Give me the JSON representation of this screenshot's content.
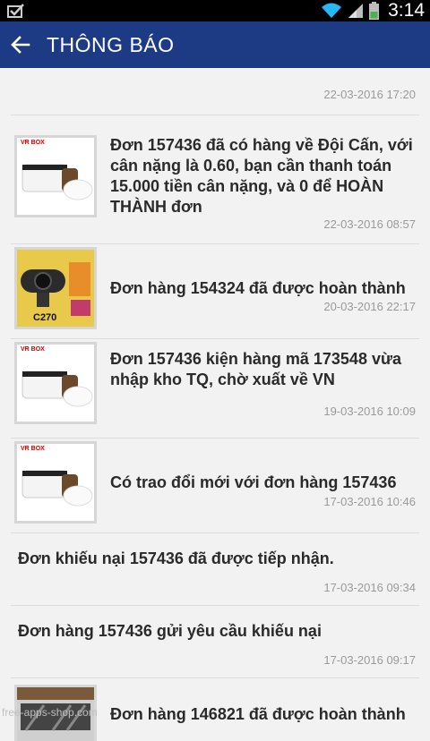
{
  "status_bar": {
    "time": "3:14"
  },
  "app_bar": {
    "title": "THÔNG BÁO"
  },
  "notifications": [
    {
      "message": "",
      "timestamp": "22-03-2016 17:20",
      "thumbnail": "none"
    },
    {
      "message": "Đơn 157436 đã có hàng về Đội Cấn, với cân nặng là 0.60, bạn cần thanh toán 15.000 tiền cân nặng, và 0 để HOÀN THÀNH đơn",
      "timestamp": "22-03-2016 08:57",
      "thumbnail": "vr-headset"
    },
    {
      "message": "Đơn hàng 154324 đã được hoàn thành",
      "timestamp": "20-03-2016 22:17",
      "thumbnail": "webcam-c270"
    },
    {
      "message": "Đơn 157436 kiện hàng mã 173548 vừa nhập kho TQ, chờ xuất về VN",
      "timestamp": "19-03-2016 10:09",
      "thumbnail": "vr-headset"
    },
    {
      "message": "Có trao đổi mới với đơn hàng 157436",
      "timestamp": "17-03-2016 10:46",
      "thumbnail": "vr-headset"
    },
    {
      "message": "Đơn khiếu nại 157436 đã được tiếp nhận.",
      "timestamp": "17-03-2016 09:34",
      "thumbnail": "none"
    },
    {
      "message": "Đơn hàng 157436 gửi yêu cầu khiếu nại",
      "timestamp": "17-03-2016 09:17",
      "thumbnail": "none"
    },
    {
      "message": "Đơn hàng 146821 đã được hoàn thành",
      "timestamp": "",
      "thumbnail": "product-photo"
    }
  ],
  "thumbnail_text": {
    "vr_brand": "VR BOX",
    "webcam_model": "C270"
  },
  "watermark": "free-apps-shop.com",
  "colors": {
    "app_bar": "#1d3a85",
    "background": "#f2f2f2",
    "text": "#2a2a2a",
    "timestamp": "#9a9a9a"
  }
}
